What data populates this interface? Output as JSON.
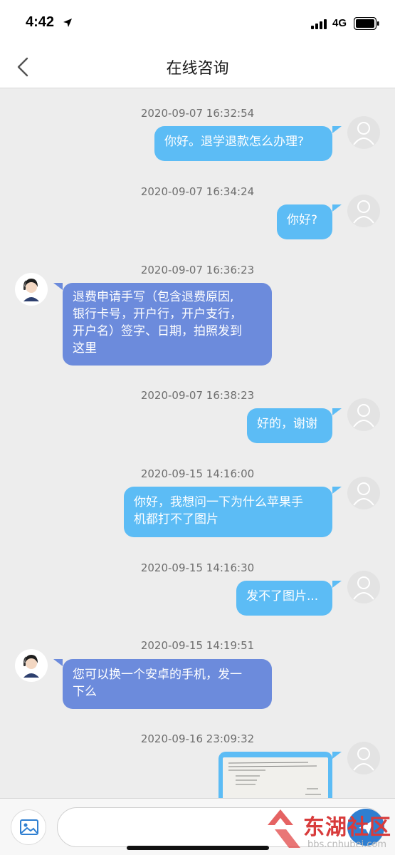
{
  "status_bar": {
    "time": "4:42",
    "network": "4G"
  },
  "nav": {
    "title": "在线咨询"
  },
  "messages": [
    {
      "timestamp": "2020-09-07 16:32:54",
      "sender": "user",
      "text": "你好。退学退款怎么办理?"
    },
    {
      "timestamp": "2020-09-07 16:34:24",
      "sender": "user",
      "text": "你好?"
    },
    {
      "timestamp": "2020-09-07 16:36:23",
      "sender": "agent",
      "lines": [
        "退费申请手写（包含退费原因,",
        "银行卡号，开户行，开户支行，",
        "开户名）签字、日期，拍照发到",
        "这里"
      ]
    },
    {
      "timestamp": "2020-09-07 16:38:23",
      "sender": "user",
      "text": "好的，谢谢"
    },
    {
      "timestamp": "2020-09-15 14:16:00",
      "sender": "user",
      "lines": [
        "你好，我想问一下为什么苹果手",
        "机都打不了图片"
      ]
    },
    {
      "timestamp": "2020-09-15 14:16:30",
      "sender": "user",
      "text": "发不了图片..."
    },
    {
      "timestamp": "2020-09-15 14:19:51",
      "sender": "agent",
      "lines": [
        "您可以换一个安卓的手机，发一",
        "下么"
      ]
    },
    {
      "timestamp": "2020-09-16 23:09:32",
      "sender": "user",
      "type": "image"
    }
  ],
  "input": {
    "placeholder": ""
  },
  "watermark": {
    "brand": "东湖社区",
    "url": "bbs.cnhubei.com"
  },
  "colors": {
    "user_bubble": "#5cbcf5",
    "agent_bubble": "#6c8bdc",
    "background": "#ededed"
  }
}
